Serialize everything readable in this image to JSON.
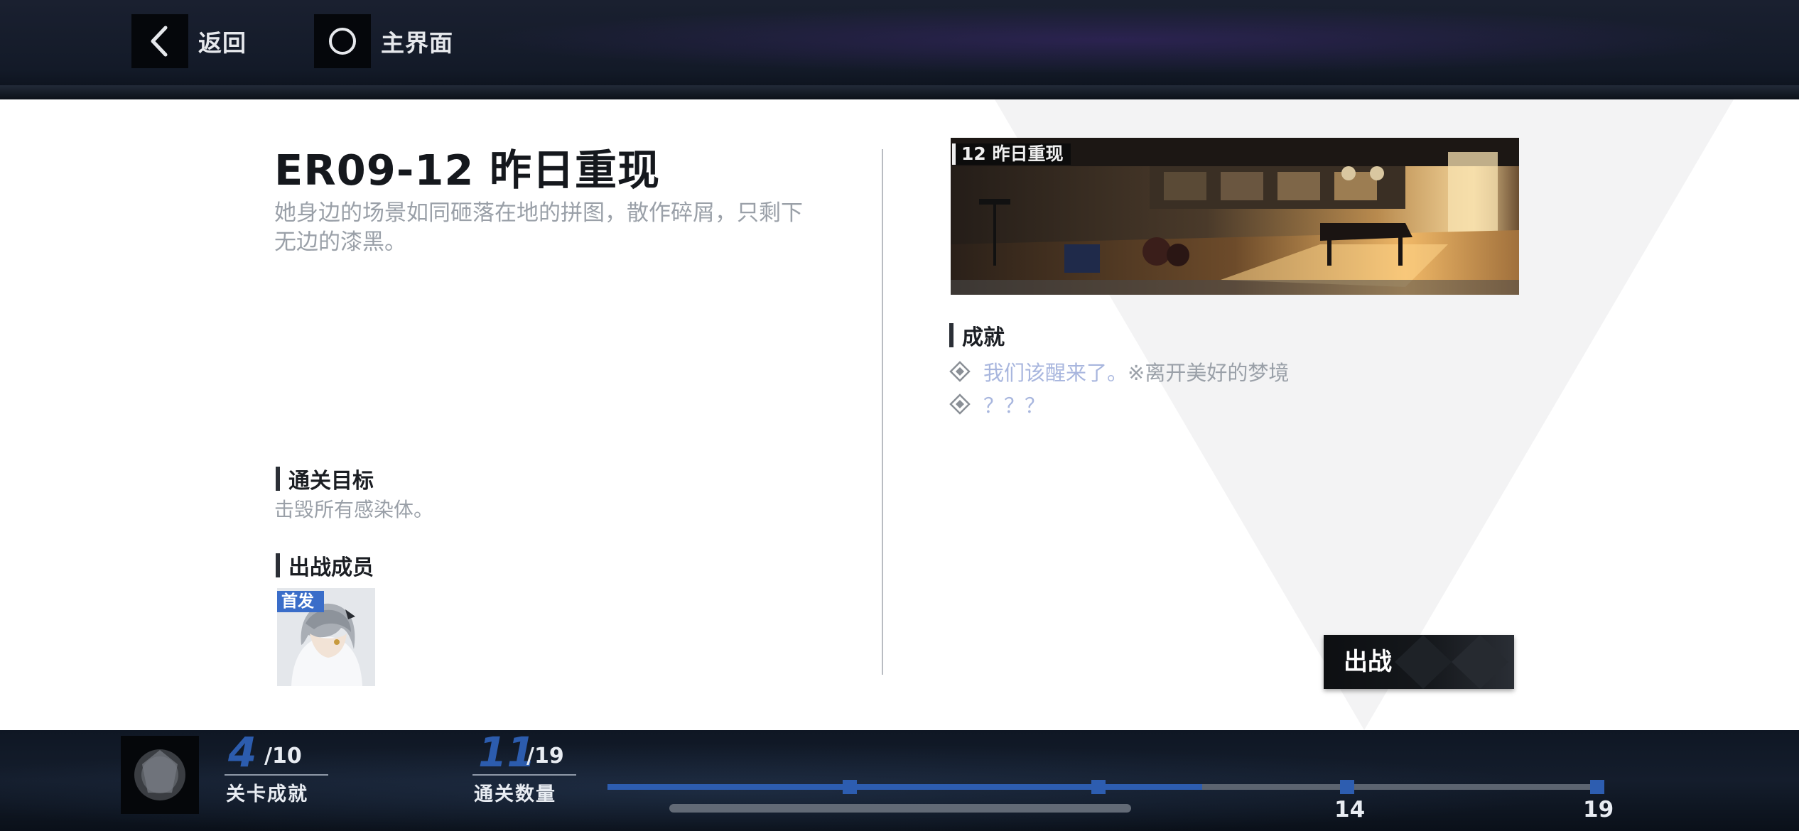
{
  "nav": {
    "back_label": "返回",
    "home_label": "主界面"
  },
  "stage": {
    "title": "ER09-12 昨日重现",
    "description": "她身边的场景如同砸落在地的拼图，散作碎屑，只剩下无边的漆黑。",
    "image_tag": "12 昨日重现"
  },
  "objective": {
    "heading": "通关目标",
    "text": "击毁所有感染体。"
  },
  "members": {
    "heading": "出战成员",
    "lead_tag": "首发"
  },
  "achievements": {
    "heading": "成就",
    "items": [
      {
        "name": "我们该醒来了。",
        "note": "※离开美好的梦境"
      },
      {
        "name": "？？？",
        "note": ""
      }
    ]
  },
  "deploy": {
    "label": "出战"
  },
  "footer": {
    "stage_achievement": {
      "count": "4",
      "total": "/10",
      "label": "关卡成就"
    },
    "clear_count": {
      "count": "11",
      "total": "/19",
      "label": "通关数量"
    },
    "milestones": [
      "14",
      "19"
    ],
    "progress": 0.6
  },
  "colors": {
    "accent_blue": "#2d5db0",
    "achievement_name": "#a8b6de",
    "panel_bg": "#ffffff"
  }
}
